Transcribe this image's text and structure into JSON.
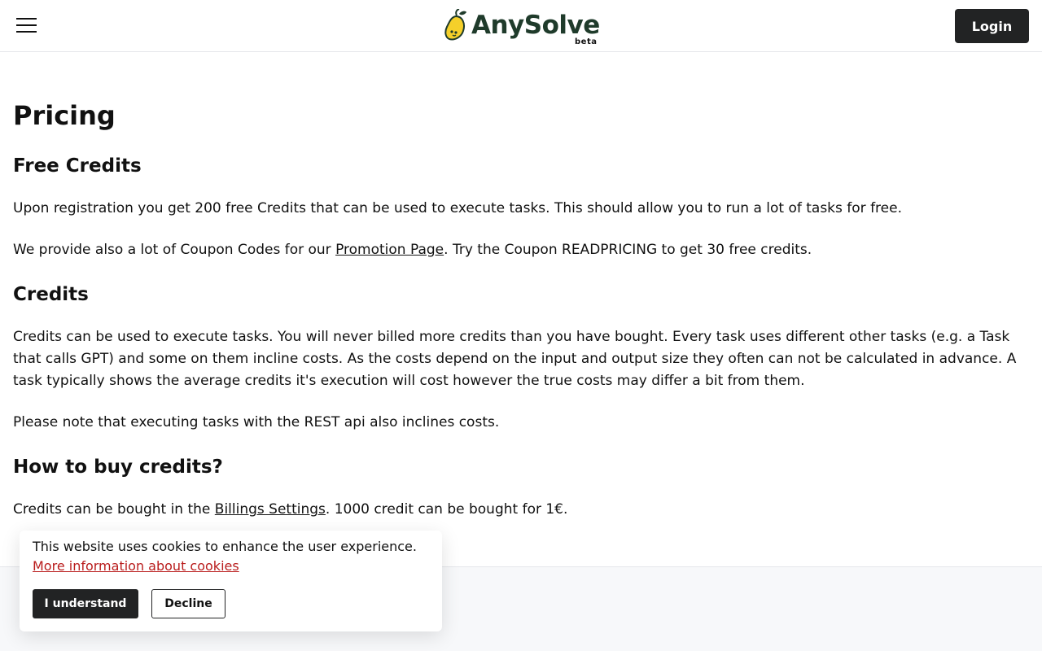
{
  "header": {
    "brand": "AnySolve",
    "beta_label": "beta",
    "login_label": "Login",
    "brand_color": "#1f3b2b",
    "logo_icon": "lemon-icon"
  },
  "main": {
    "title": "Pricing",
    "sections": [
      {
        "heading": "Free Credits",
        "paragraphs": [
          {
            "text": "Upon registration you get 200 free Credits that can be used to execute tasks. This should allow you to run a lot of tasks for free."
          },
          {
            "before": "We provide also a lot of Coupon Codes for our ",
            "link": "Promotion Page",
            "after": ". Try the Coupon READPRICING to get 30 free credits."
          }
        ]
      },
      {
        "heading": "Credits",
        "paragraphs": [
          {
            "text": "Credits can be used to execute tasks. You will never billed more credits than you have bought. Every task uses different other tasks (e.g. a Task that calls GPT) and some on them incline costs. As the costs depend on the input and output size they often can not be calculated in advance. A task typically shows the average credits it's execution will cost however the true costs may differ a bit from them."
          },
          {
            "text": "Please note that executing tasks with the REST api also inclines costs."
          }
        ]
      },
      {
        "heading": "How to buy credits?",
        "paragraphs": [
          {
            "before": "Credits can be bought in the ",
            "link": "Billings Settings",
            "after": ". 1000 credit can be bought for 1€."
          }
        ]
      }
    ]
  },
  "cookie_banner": {
    "message": "This website uses cookies to enhance the user experience.",
    "info_link": "More information about cookies",
    "accept_label": "I understand",
    "decline_label": "Decline",
    "link_color": "#b91c1c"
  }
}
